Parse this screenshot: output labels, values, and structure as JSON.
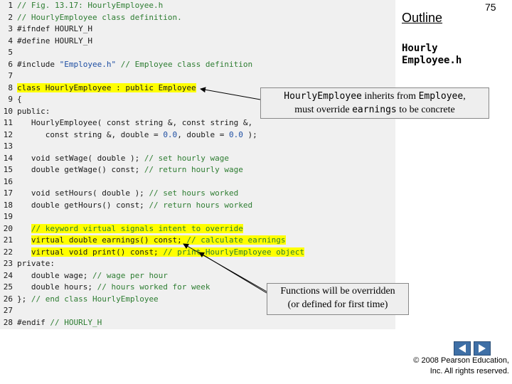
{
  "header": {
    "title": "Outline",
    "page_number": "75",
    "file_label": "Hourly Employee.h"
  },
  "code_lines": [
    {
      "n": "1",
      "html": "<span class=\"cm\">// Fig. 13.17: HourlyEmployee.h</span>"
    },
    {
      "n": "2",
      "html": "<span class=\"cm\">// HourlyEmployee class definition.</span>"
    },
    {
      "n": "3",
      "html": "<span class=\"pp\">#ifndef HOURLY_H</span>"
    },
    {
      "n": "4",
      "html": "<span class=\"pp\">#define HOURLY_H</span>"
    },
    {
      "n": "5",
      "html": ""
    },
    {
      "n": "6",
      "html": "<span class=\"pp\">#include </span><span class=\"str\">\"Employee.h\"</span><span class=\"cm\"> // Employee class definition</span>"
    },
    {
      "n": "7",
      "html": ""
    },
    {
      "n": "8",
      "html": "<span class=\"hl\">class HourlyEmployee : public Employee</span>"
    },
    {
      "n": "9",
      "html": "{"
    },
    {
      "n": "10",
      "html": "public:"
    },
    {
      "n": "11",
      "html": "   HourlyEmployee( const string &amp;, const string &amp;,"
    },
    {
      "n": "12",
      "html": "      const string &amp;, double = <span class=\"num\">0.0</span>, double = <span class=\"num\">0.0</span> );"
    },
    {
      "n": "13",
      "html": ""
    },
    {
      "n": "14",
      "html": "   void setWage( double ); <span class=\"cm\">// set hourly wage</span>"
    },
    {
      "n": "15",
      "html": "   double getWage() const; <span class=\"cm\">// return hourly wage</span>"
    },
    {
      "n": "16",
      "html": ""
    },
    {
      "n": "17",
      "html": "   void setHours( double ); <span class=\"cm\">// set hours worked</span>"
    },
    {
      "n": "18",
      "html": "   double getHours() const; <span class=\"cm\">// return hours worked</span>"
    },
    {
      "n": "19",
      "html": ""
    },
    {
      "n": "20",
      "html": "   <span class=\"hl\"><span class=\"cm\">// keyword virtual signals intent to override</span></span>"
    },
    {
      "n": "21",
      "html": "   <span class=\"hl\">virtual double earnings() const; <span class=\"cm\">// calculate earnings</span></span>"
    },
    {
      "n": "22",
      "html": "   <span class=\"hl\">virtual void print() const; <span class=\"cm\">// print HourlyEmployee object</span></span>"
    },
    {
      "n": "23",
      "html": "private:"
    },
    {
      "n": "24",
      "html": "   double wage; <span class=\"cm\">// wage per hour</span>"
    },
    {
      "n": "25",
      "html": "   double hours; <span class=\"cm\">// hours worked for week</span>"
    },
    {
      "n": "26",
      "html": "}; <span class=\"cm\">// end class HourlyEmployee</span>"
    },
    {
      "n": "27",
      "html": ""
    },
    {
      "n": "28",
      "html": "<span class=\"pp\">#endif</span><span class=\"cm\"> // HOURLY_H</span>"
    }
  ],
  "callout1": {
    "part1": "HourlyEmployee",
    "part2": " inherits from ",
    "part3": "Employee",
    "part4": ",",
    "part5": "must override ",
    "part6": "earnings",
    "part7": " to be concrete"
  },
  "callout2": {
    "line1": "Functions will be overridden",
    "line2": "(or defined for first time)"
  },
  "footer": {
    "copyright_line1": "© 2008 Pearson Education,",
    "copyright_line2": "Inc.  All rights reserved."
  },
  "colors": {
    "highlight": "#ffff00",
    "comment": "#2e7d32",
    "literal": "#1f4fa3",
    "nav_button": "#3e6fa6"
  }
}
